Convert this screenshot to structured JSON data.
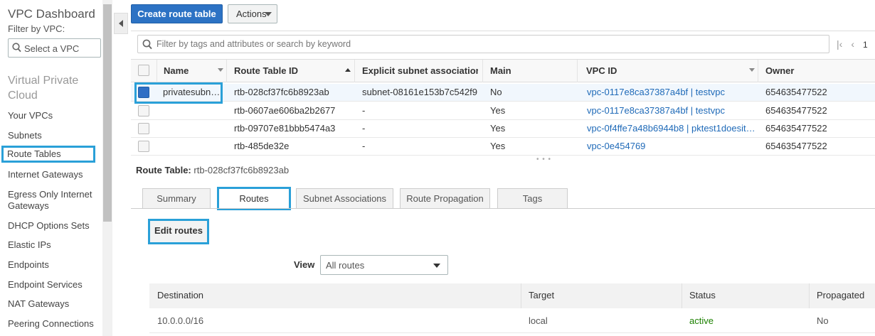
{
  "sidebar": {
    "title": "VPC Dashboard",
    "filter_label": "Filter by VPC:",
    "select_placeholder": "Select a VPC",
    "section": "Virtual Private Cloud",
    "items": [
      {
        "label": "Your VPCs"
      },
      {
        "label": "Subnets"
      },
      {
        "label": "Route Tables"
      },
      {
        "label": "Internet Gateways"
      },
      {
        "label": "Egress Only Internet Gateways"
      },
      {
        "label": "DHCP Options Sets"
      },
      {
        "label": "Elastic IPs"
      },
      {
        "label": "Endpoints"
      },
      {
        "label": "Endpoint Services"
      },
      {
        "label": "NAT Gateways"
      },
      {
        "label": "Peering Connections"
      }
    ]
  },
  "toolbar": {
    "create_label": "Create route table",
    "actions_label": "Actions",
    "filter_placeholder": "Filter by tags and attributes or search by keyword",
    "page": "1"
  },
  "table": {
    "columns": [
      "Name",
      "Route Table ID",
      "Explicit subnet associatior",
      "Main",
      "VPC ID",
      "Owner"
    ],
    "rows": [
      {
        "name": "privatesubn…",
        "id": "rtb-028cf37fc6b8923ab",
        "subnet": "subnet-08161e153b7c542f9",
        "main": "No",
        "vpc": "vpc-0117e8ca37387a4bf | testvpc",
        "owner": "654635477522",
        "selected": true
      },
      {
        "name": "",
        "id": "rtb-0607ae606ba2b2677",
        "subnet": "-",
        "main": "Yes",
        "vpc": "vpc-0117e8ca37387a4bf | testvpc",
        "owner": "654635477522",
        "selected": false
      },
      {
        "name": "",
        "id": "rtb-09707e81bbb5474a3",
        "subnet": "-",
        "main": "Yes",
        "vpc": "vpc-0f4ffe7a48b6944b8 | pktest1doesit…",
        "owner": "654635477522",
        "selected": false
      },
      {
        "name": "",
        "id": "rtb-485de32e",
        "subnet": "-",
        "main": "Yes",
        "vpc": "vpc-0e454769",
        "owner": "654635477522",
        "selected": false
      }
    ]
  },
  "detail": {
    "label": "Route Table:",
    "value": "rtb-028cf37fc6b8923ab",
    "tabs": [
      "Summary",
      "Routes",
      "Subnet Associations",
      "Route Propagation",
      "Tags"
    ],
    "active_tab": "Routes",
    "edit_label": "Edit routes",
    "view_label": "View",
    "view_value": "All routes",
    "routes_columns": [
      "Destination",
      "Target",
      "Status",
      "Propagated"
    ],
    "routes": [
      {
        "destination": "10.0.0.0/16",
        "target": "local",
        "status": "active",
        "propagated": "No"
      }
    ]
  },
  "colors": {
    "primary": "#2c72c4",
    "link": "#1f6ab8",
    "highlight": "#2aa0d8",
    "active_status": "#1d8102"
  }
}
